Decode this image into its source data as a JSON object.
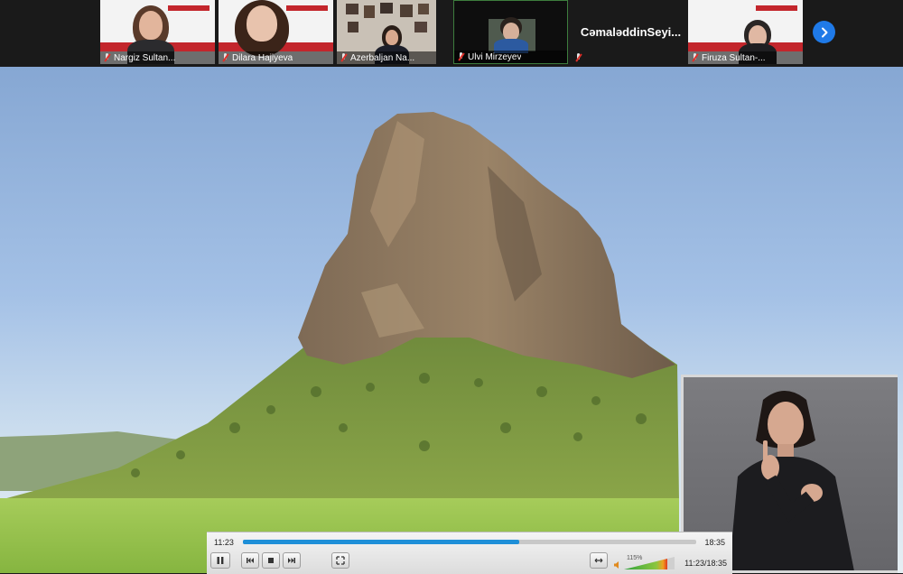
{
  "participants": [
    {
      "name": "Nargiz Sultan...",
      "muted": true
    },
    {
      "name": "Dilara Hajiyeva",
      "muted": true
    },
    {
      "name": "Azerbaljan Na...",
      "muted": true
    },
    {
      "name": "Ulvi Mirzeyev",
      "muted": true
    },
    {
      "name": "CəmaləddinSeyi...",
      "muted": true
    },
    {
      "name": "Firuza Sultan-...",
      "muted": true
    }
  ],
  "next_button": {
    "icon": "chevron-right-icon"
  },
  "player": {
    "elapsed": "11:23",
    "total": "18:35",
    "progress_fraction": 0.61,
    "volume_percent": "115%",
    "combined_time": "11:23/18:35",
    "buttons": [
      "pause-icon",
      "previous-icon",
      "stop-icon",
      "next-icon",
      "fullscreen-icon",
      "aspect-icon"
    ]
  },
  "colors": {
    "accent": "#1f7ae8",
    "seek_fill": "#1e8fd8",
    "poster_red": "#c3262c"
  }
}
